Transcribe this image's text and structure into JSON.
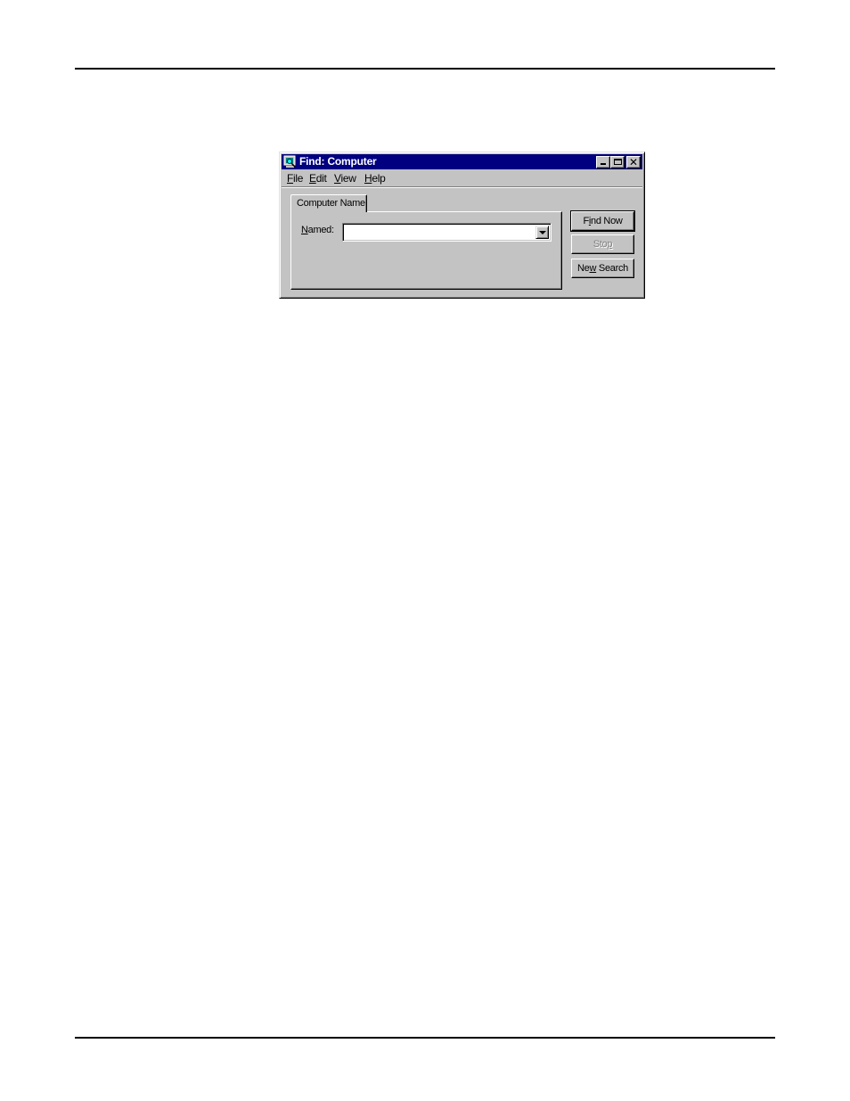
{
  "page": {
    "rules": [
      "top",
      "bottom"
    ]
  },
  "window": {
    "title": "Find: Computer",
    "title_icon": "find-computer-icon",
    "controls": {
      "minimize": "minimize-icon",
      "maximize": "maximize-icon",
      "close": "close-icon",
      "close_glyph": "✕"
    },
    "colors": {
      "titlebar": "#000080",
      "face": "#c3c3c3"
    }
  },
  "menu": {
    "items": [
      {
        "label": "File",
        "mnemonic": "F",
        "rest": "ile"
      },
      {
        "label": "Edit",
        "mnemonic": "E",
        "rest": "dit"
      },
      {
        "label": "View",
        "mnemonic": "V",
        "rest": "iew"
      },
      {
        "label": "Help",
        "mnemonic": "H",
        "rest": "elp"
      }
    ]
  },
  "tabs": [
    {
      "label": "Computer Name",
      "active": true
    }
  ],
  "form": {
    "named_label_mnemonic": "N",
    "named_label_rest": "amed:",
    "named_value": "",
    "named_placeholder": ""
  },
  "buttons": {
    "find_now": {
      "pre": "F",
      "mnemonic": "i",
      "post": "nd Now",
      "enabled": true,
      "default": true
    },
    "stop": {
      "pre": "Sto",
      "mnemonic": "p",
      "post": "",
      "enabled": false
    },
    "new_search": {
      "pre": "Ne",
      "mnemonic": "w",
      "post": " Search",
      "enabled": true
    }
  }
}
